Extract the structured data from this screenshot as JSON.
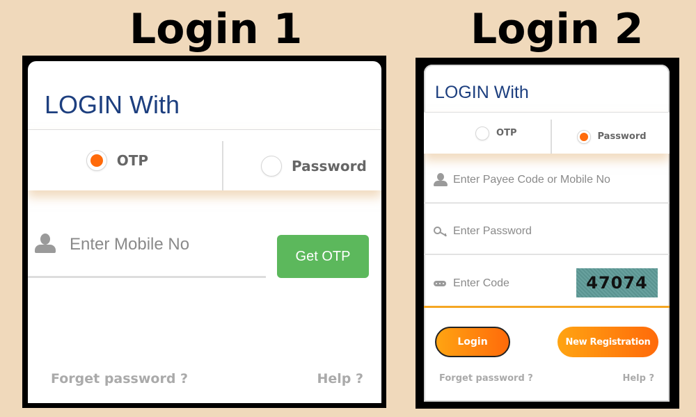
{
  "headings": {
    "login1": "Login 1",
    "login2": "Login 2"
  },
  "login1": {
    "title": "LOGIN With",
    "tabs": [
      {
        "label": "OTP",
        "selected": true
      },
      {
        "label": "Password",
        "selected": false
      }
    ],
    "mobile_placeholder": "Enter Mobile No",
    "get_otp_label": "Get OTP",
    "forget_password": "Forget password ?",
    "help": "Help ?"
  },
  "login2": {
    "title": "LOGIN With",
    "tabs": [
      {
        "label": "OTP",
        "selected": false
      },
      {
        "label": "Password",
        "selected": true
      }
    ],
    "payee_placeholder": "Enter Payee Code or Mobile No",
    "password_placeholder": "Enter Password",
    "code_placeholder": "Enter Code",
    "captcha_value": "47074",
    "login_label": "Login",
    "new_registration_label": "New Registration",
    "forget_password": "Forget password ?",
    "help": "Help ?"
  },
  "colors": {
    "background": "#f0d9bb",
    "title_blue": "#1d3f7f",
    "radio_orange": "#ff6a0a",
    "otp_green": "#5cb85c",
    "active_underline": "#f5a623",
    "captcha_bg": "#5f9b98"
  }
}
